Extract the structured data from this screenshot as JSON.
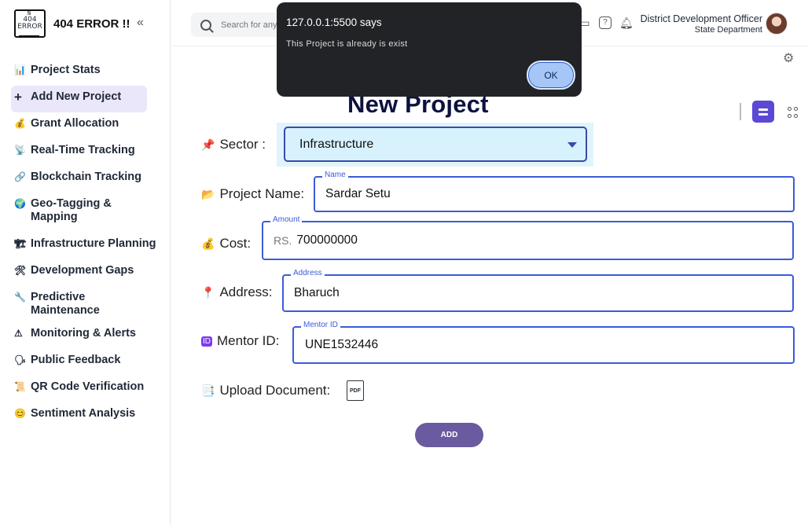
{
  "brand": {
    "logo_text": "404\nERROR",
    "title": "404 ERROR !!"
  },
  "sidebar": {
    "items": [
      {
        "icon": "📊",
        "label": "Project Stats"
      },
      {
        "icon": "+",
        "label": "Add New Project",
        "active": true
      },
      {
        "icon": "💰",
        "label": "Grant Allocation"
      },
      {
        "icon": "📡",
        "label": "Real-Time Tracking"
      },
      {
        "icon": "🔗",
        "label": "Blockchain Tracking"
      },
      {
        "icon": "🌍",
        "label": "Geo-Tagging & Mapping"
      },
      {
        "icon": "🏗",
        "label": "Infrastructure Planning"
      },
      {
        "icon": "🛠",
        "label": "Development Gaps"
      },
      {
        "icon": "🔧",
        "label": "Predictive Maintenance"
      },
      {
        "icon": "⚠",
        "label": "Monitoring & Alerts"
      },
      {
        "icon": "🗣",
        "label": "Public Feedback"
      },
      {
        "icon": "📜",
        "label": "QR Code Verification"
      },
      {
        "icon": "😊",
        "label": "Sentiment Analysis"
      }
    ]
  },
  "header": {
    "search_placeholder": "Search for anything...",
    "user_name": "District Development Officer",
    "user_role": "State Department"
  },
  "form": {
    "title": "New Project",
    "sector_label": "Sector :",
    "sector_value": "Infrastructure",
    "name_label": "Project Name:",
    "name_legend": "Name",
    "name_value": "Sardar Setu",
    "cost_label": "Cost:",
    "cost_legend": "Amount",
    "cost_prefix": "RS.",
    "cost_value": "700000000",
    "address_label": "Address:",
    "address_legend": "Address",
    "address_value": "Bharuch",
    "mentor_label": "Mentor ID:",
    "mentor_legend": "Mentor ID",
    "mentor_value": "UNE1532446",
    "upload_label": "Upload Document:",
    "pdf_text": "PDF",
    "add_label": "ADD"
  },
  "alert": {
    "title": "127.0.0.1:5500 says",
    "message": "This Project is already is exist",
    "ok_label": "OK"
  }
}
